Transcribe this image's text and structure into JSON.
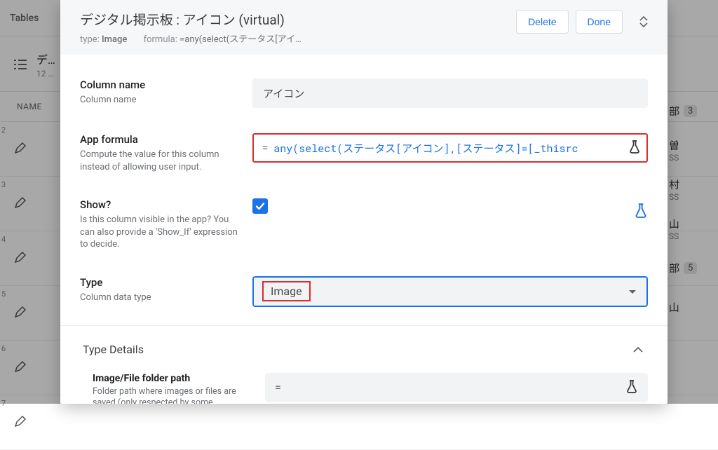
{
  "background": {
    "tables_label": "Tables",
    "sheet_name": "デ…",
    "sheet_sub": "12 …",
    "col_header": "NAME",
    "rows": [
      "2",
      "3",
      "4",
      "5",
      "6",
      "7"
    ],
    "right_items": [
      {
        "text": "部",
        "badge": "3"
      },
      {
        "text": "曽",
        "sub": "SS"
      },
      {
        "text": "村",
        "sub": "SS"
      },
      {
        "text": "山",
        "sub": "SS"
      },
      {
        "text": "部",
        "badge": "5"
      },
      {
        "text": "山",
        "sub": ""
      }
    ]
  },
  "dialog": {
    "title": "デジタル掲示板 : アイコン (virtual)",
    "subtitle_type_label": "type:",
    "subtitle_type_value": "Image",
    "subtitle_formula_label": "formula:",
    "subtitle_formula_value": "=any(select(ステータス[アイ…",
    "delete": "Delete",
    "done": "Done"
  },
  "fields": {
    "column_name": {
      "label": "Column name",
      "help": "Column name",
      "value": "アイコン"
    },
    "app_formula": {
      "label": "App formula",
      "help": "Compute the value for this column instead of allowing user input.",
      "eq": "=",
      "value": "any(select(ステータス[アイコン],[ステータス]=[_thisrc"
    },
    "show": {
      "label": "Show?",
      "help": "Is this column visible in the app? You can also provide a 'Show_If' expression to decide.",
      "checked": true
    },
    "type": {
      "label": "Type",
      "help": "Column data type",
      "value": "Image"
    },
    "type_details": {
      "label": "Type Details"
    },
    "folder_path": {
      "label": "Image/File folder path",
      "help": "Folder path where images or files are saved (only respected by some",
      "eq": "="
    }
  }
}
